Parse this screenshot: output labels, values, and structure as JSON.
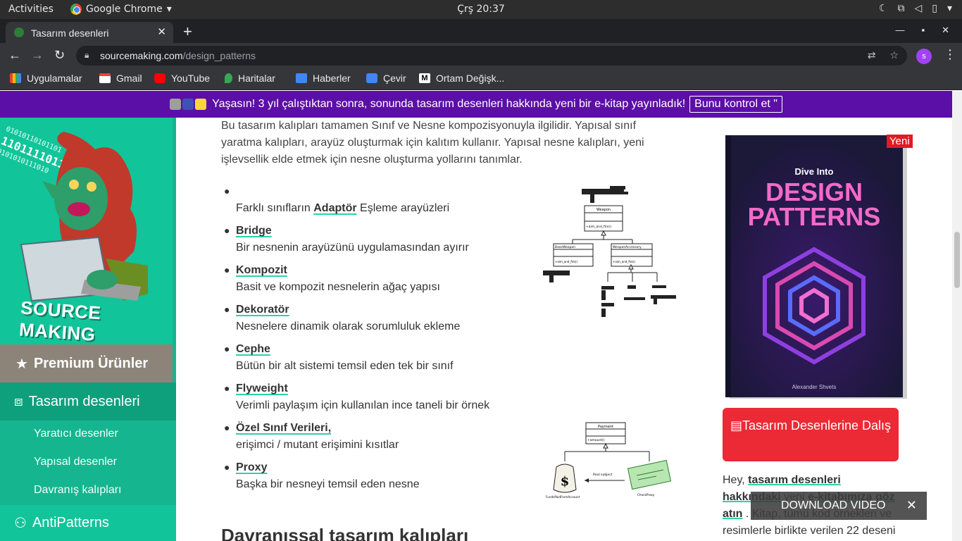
{
  "os": {
    "activities": "Activities",
    "app_name": "Google Chrome",
    "clock": "Çrş 20:37"
  },
  "browser": {
    "tab_title": "Tasarım desenleri",
    "url_host": "sourcemaking.com",
    "url_path": "/design_patterns",
    "profile_initial": "s",
    "bookmarks": [
      {
        "label": "Uygulamalar",
        "icon": "apps-grid-icon"
      },
      {
        "label": "Gmail",
        "icon": "gmail-icon"
      },
      {
        "label": "YouTube",
        "icon": "youtube-icon"
      },
      {
        "label": "Haritalar",
        "icon": "maps-pin-icon"
      },
      {
        "label": "Haberler",
        "icon": "news-icon"
      },
      {
        "label": "Çevir",
        "icon": "translate-icon"
      },
      {
        "label": "Ortam Değişk...",
        "icon": "medium-icon"
      }
    ]
  },
  "banner": {
    "text": "Yaşasın! 3 yıl çalıştıktan sonra, sonunda tasarım desenleri hakkında yeni bir e-kitap yayınladık!",
    "cta": "Bunu kontrol et \""
  },
  "sidebar": {
    "logo_text": "SOURCE MAKING",
    "premium": "Premium Ürünler",
    "design_patterns": "Tasarım desenleri",
    "subitems": [
      "Yaratıcı desenler",
      "Yapısal desenler",
      "Davranış kalıpları"
    ],
    "antipatterns": "AntiPatterns"
  },
  "main": {
    "intro": "Bu tasarım kalıpları tamamen Sınıf ve Nesne kompozisyonuyla ilgilidir. Yapısal sınıf yaratma kalıpları, arayüz oluşturmak için kalıtım kullanır. Yapısal nesne kalıpları, yeni işlevsellik elde etmek için nesne oluşturma yollarını tanımlar.",
    "patterns": [
      {
        "name": "",
        "desc_pre": "Farklı sınıfların ",
        "desc_link": "Adaptör",
        "desc_post": " Eşleme arayüzleri"
      },
      {
        "name": "Bridge",
        "desc": "Bir nesnenin arayüzünü uygulamasından ayırır"
      },
      {
        "name": "Kompozit",
        "desc": "Basit ve kompozit nesnelerin ağaç yapısı"
      },
      {
        "name": "Dekoratör",
        "desc": "Nesnelere dinamik olarak sorumluluk ekleme"
      },
      {
        "name": "Cephe",
        "desc": "Bütün bir alt sistemi temsil eden tek bir sınıf"
      },
      {
        "name": "Flyweight",
        "desc": "Verimli paylaşım için kullanılan ince taneli bir örnek"
      },
      {
        "name": "Özel Sınıf Verileri,",
        "desc": "erişimci / mutant erişimini kısıtlar"
      },
      {
        "name": "Proxy",
        "desc": "Başka bir nesneyi temsil eden nesne"
      }
    ],
    "next_heading": "Davranışsal tasarım kalıpları",
    "diagram1": {
      "top": "Weapon",
      "method": "+aim_and_fire()",
      "left": "BaseWeapon",
      "right": "WeaponAccessory",
      "left_method": "+aim_and_fire()",
      "right_method": "+aim_and_fire()"
    },
    "diagram2": {
      "top": "Payment",
      "method": "+amount()",
      "arrow": "Real subject",
      "left": "FundsPaidFromAccount",
      "right": "CheckProxy"
    }
  },
  "promo": {
    "badge": "Yeni",
    "book_small": "Dive Into",
    "book_big1": "DESIGN",
    "book_big2": "PATTERNS",
    "book_author": "Alexander Shvets",
    "button": "Tasarım Desenlerine Dalış",
    "hey_pre": "Hey, ",
    "hey_link1": "tasarım desenleri hakkındaki",
    "hey_mid": " yeni ",
    "hey_link2": "e-kitabımıza göz atın",
    "hey_post": " . Kitap, tümü kod örnekleri ve resimlerle birlikte verilen 22 deseni",
    "download": "DOWNLOAD VIDEO"
  }
}
